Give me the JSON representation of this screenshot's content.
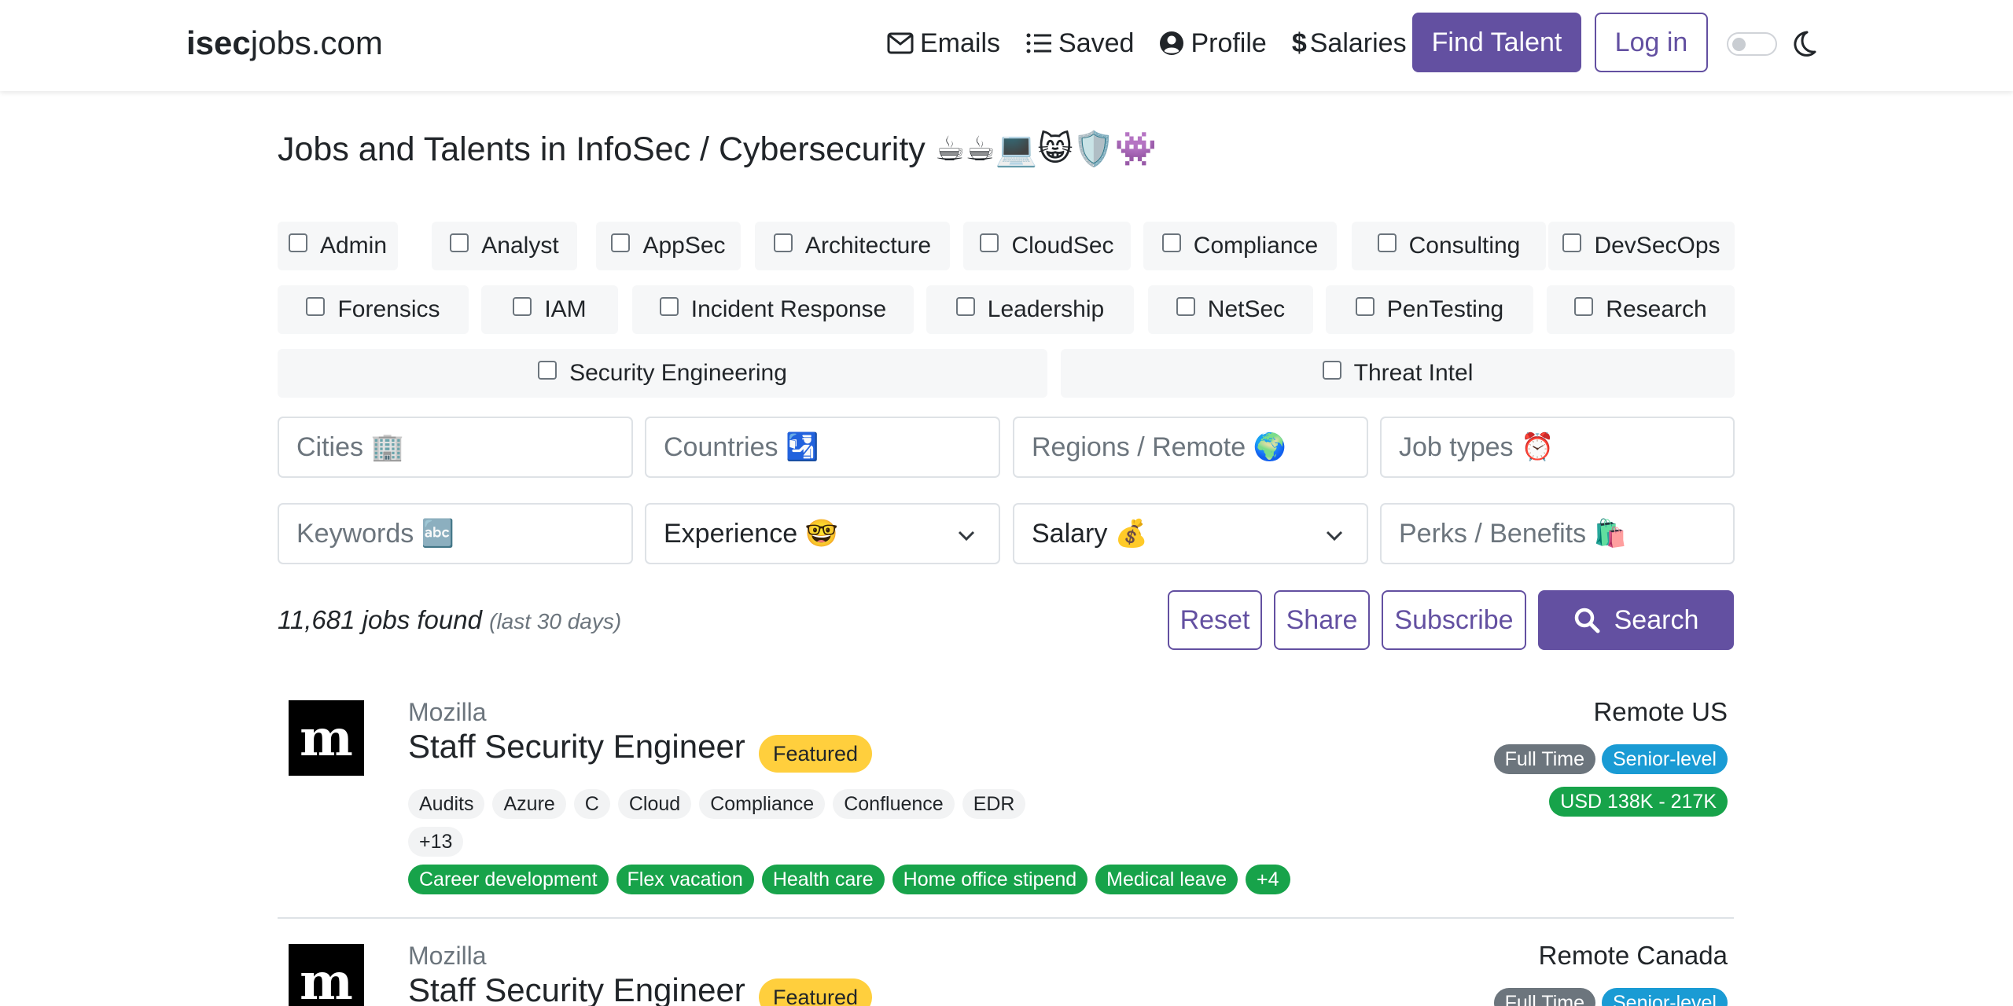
{
  "colors": {
    "primary": "#6350a1",
    "featured": "#ffcf3d",
    "perk": "#17a34a",
    "senior": "#1a9bd4",
    "type": "#6c757d"
  },
  "header": {
    "brand_bold": "isec",
    "brand_rest": "jobs.com",
    "nav": [
      {
        "icon": "envelope-icon",
        "label": "Emails"
      },
      {
        "icon": "list-icon",
        "label": "Saved"
      },
      {
        "icon": "user-circle-icon",
        "label": "Profile"
      },
      {
        "icon": "dollar-icon",
        "label": "Salaries"
      }
    ],
    "find_talent": "Find Talent",
    "login": "Log in",
    "theme_icon": "moon-icon"
  },
  "title": "Jobs and Talents in InfoSec / Cybersecurity ☕☕💻😸🛡️👾",
  "categories": [
    "Admin",
    "Analyst",
    "AppSec",
    "Architecture",
    "CloudSec",
    "Compliance",
    "Consulting",
    "DevSecOps",
    "Forensics",
    "IAM",
    "Incident Response",
    "Leadership",
    "NetSec",
    "PenTesting",
    "Research",
    "Security Engineering",
    "Threat Intel"
  ],
  "filters": {
    "cities": "Cities 🏢",
    "countries": "Countries 🛂",
    "regions": "Regions / Remote 🌍",
    "job_types": "Job types ⏰",
    "keywords": "Keywords 🔤",
    "experience": "Experience 🤓",
    "salary": "Salary 💰",
    "perks": "Perks / Benefits 🛍️"
  },
  "results": {
    "count": "11,681 jobs found",
    "period": "(last 30 days)",
    "reset": "Reset",
    "share": "Share",
    "subscribe": "Subscribe",
    "search": "Search"
  },
  "jobs": [
    {
      "company": "Mozilla",
      "logo_letter": "m",
      "title": "Staff Security Engineer",
      "featured": "Featured",
      "tags": [
        "Audits",
        "Azure",
        "C",
        "Cloud",
        "Compliance",
        "Confluence",
        "EDR"
      ],
      "more_tags": "+13",
      "perks": [
        "Career development",
        "Flex vacation",
        "Health care",
        "Home office stipend",
        "Medical leave",
        "+4"
      ],
      "location": "Remote US",
      "type": "Full Time",
      "level": "Senior-level",
      "salary": "USD 138K - 217K"
    },
    {
      "company": "Mozilla",
      "logo_letter": "m",
      "title": "Staff Security Engineer",
      "featured": "Featured",
      "location": "Remote Canada",
      "type": "Full Time",
      "level": "Senior-level"
    }
  ]
}
